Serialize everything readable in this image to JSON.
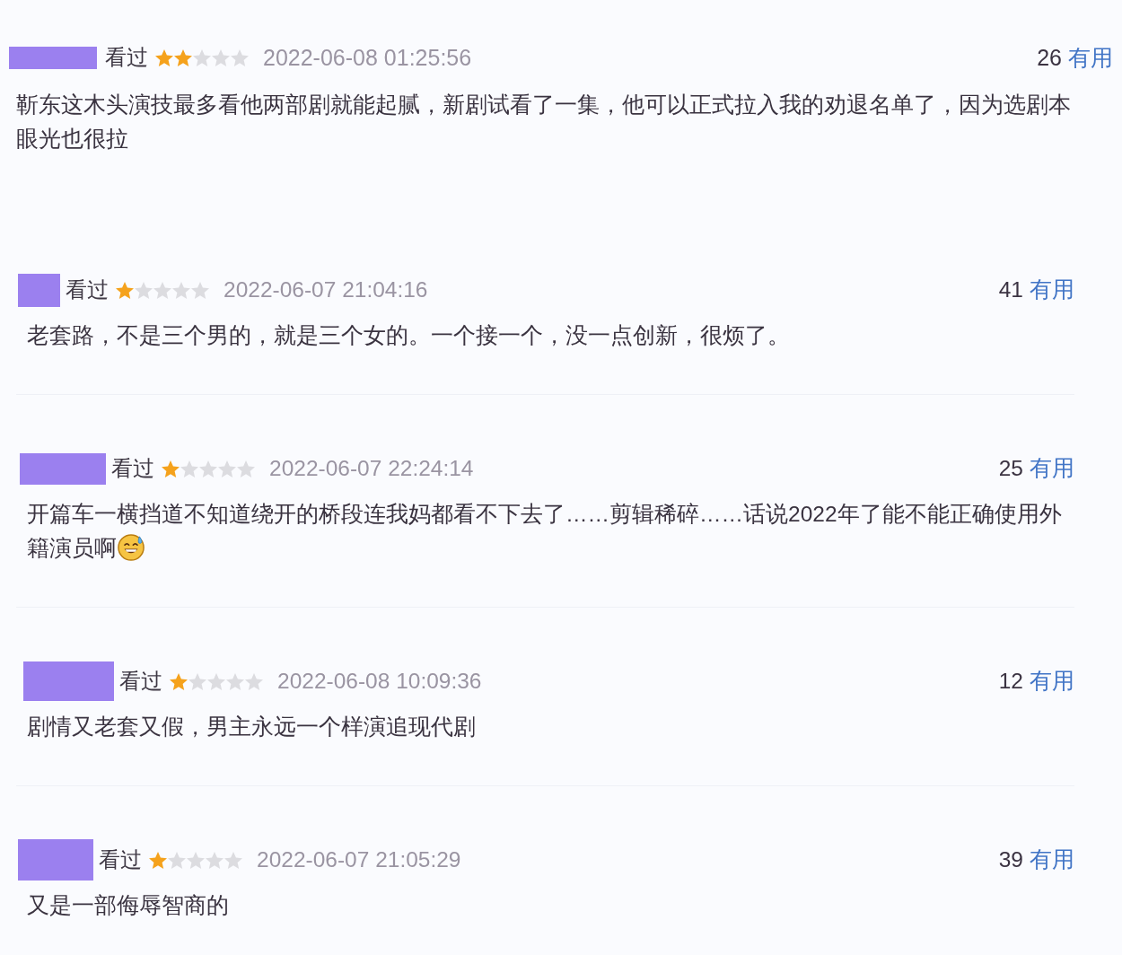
{
  "reviews": [
    {
      "username_redacted": true,
      "status": "看过",
      "stars": 2,
      "date": "2022-06-08 01:25:56",
      "useful_count": "26",
      "useful_label": "有用",
      "comment": "靳东这木头演技最多看他两部剧就能起腻，新剧试看了一集，他可以正式拉入我的劝退名单了，因为选剧本眼光也很拉",
      "ends_with_emoji": false
    },
    {
      "username_redacted": true,
      "status": "看过",
      "stars": 1,
      "date": "2022-06-07 21:04:16",
      "useful_count": "41",
      "useful_label": "有用",
      "comment": "老套路，不是三个男的，就是三个女的。一个接一个，没一点创新，很烦了。",
      "ends_with_emoji": false
    },
    {
      "username_redacted": true,
      "status": "看过",
      "stars": 1,
      "date": "2022-06-07 22:24:14",
      "useful_count": "25",
      "useful_label": "有用",
      "comment": "开篇车一横挡道不知道绕开的桥段连我妈都看不下去了……剪辑稀碎……话说2022年了能不能正确使用外籍演员啊",
      "ends_with_emoji": true
    },
    {
      "username_redacted": true,
      "status": "看过",
      "stars": 1,
      "date": "2022-06-08 10:09:36",
      "useful_count": "12",
      "useful_label": "有用",
      "comment": "剧情又老套又假，男主永远一个样演追现代剧",
      "ends_with_emoji": false
    },
    {
      "username_redacted": true,
      "status": "看过",
      "stars": 1,
      "date": "2022-06-07 21:05:29",
      "useful_count": "39",
      "useful_label": "有用",
      "comment": "又是一部侮辱智商的",
      "ends_with_emoji": false
    }
  ]
}
